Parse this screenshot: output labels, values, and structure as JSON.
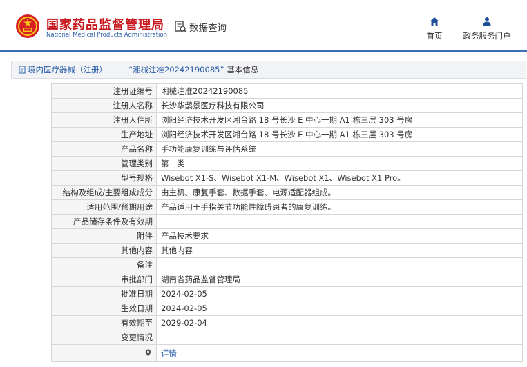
{
  "header": {
    "site_title": "国家药品监督管理局",
    "site_subtitle": "National Medical Products Administration",
    "query_label": "数据查询",
    "query_icon": "data-search-icon",
    "nav": [
      {
        "label": "首页",
        "icon": "home-icon"
      },
      {
        "label": "政务服务门户",
        "icon": "user-icon"
      }
    ],
    "colors": {
      "brand_red": "#c8161d",
      "brand_blue": "#2a5ea8",
      "nav_icon": "#1f4f99"
    }
  },
  "breadcrumb": {
    "icon": "document-icon",
    "section": "境内医疗器械（注册）",
    "separator": "——",
    "quote_open": "“",
    "reg_no": "湘械注准20242190085",
    "quote_close": "”",
    "suffix": "基本信息"
  },
  "details": [
    {
      "label": "注册证编号",
      "value": "湘械注准20242190085"
    },
    {
      "label": "注册人名称",
      "value": "长沙华鹊景医疗科技有限公司"
    },
    {
      "label": "注册人住所",
      "value": "浏阳经济技术开发区湘台路 18 号长沙 E 中心一期 A1 栋三层 303 号房"
    },
    {
      "label": "生产地址",
      "value": "浏阳经济技术开发区湘台路 18 号长沙 E 中心一期 A1 栋三层 303 号房"
    },
    {
      "label": "产品名称",
      "value": "手功能康复训练与评估系统"
    },
    {
      "label": "管理类别",
      "value": "第二类"
    },
    {
      "label": "型号规格",
      "value": "Wisebot X1-S、Wisebot X1-M、Wisebot X1、Wisebot X1 Pro。"
    },
    {
      "label": "结构及组成/主要组成成分",
      "value": "由主机、康复手套、数据手套、电源适配器组成。"
    },
    {
      "label": "适用范围/预期用途",
      "value": "产品适用于手指关节功能性障碍患者的康复训练。"
    },
    {
      "label": "产品储存条件及有效期",
      "value": ""
    },
    {
      "label": "附件",
      "value": "产品技术要求"
    },
    {
      "label": "其他内容",
      "value": "其他内容"
    },
    {
      "label": "备注",
      "value": ""
    },
    {
      "label": "审批部门",
      "value": "湖南省药品监督管理局"
    },
    {
      "label": "批准日期",
      "value": "2024-02-05"
    },
    {
      "label": "生效日期",
      "value": "2024-02-05"
    },
    {
      "label": "有效期至",
      "value": "2029-02-04"
    },
    {
      "label": "变更情况",
      "value": ""
    }
  ],
  "footer_row": {
    "icon": "map-pin-icon",
    "link_label": "详情"
  }
}
